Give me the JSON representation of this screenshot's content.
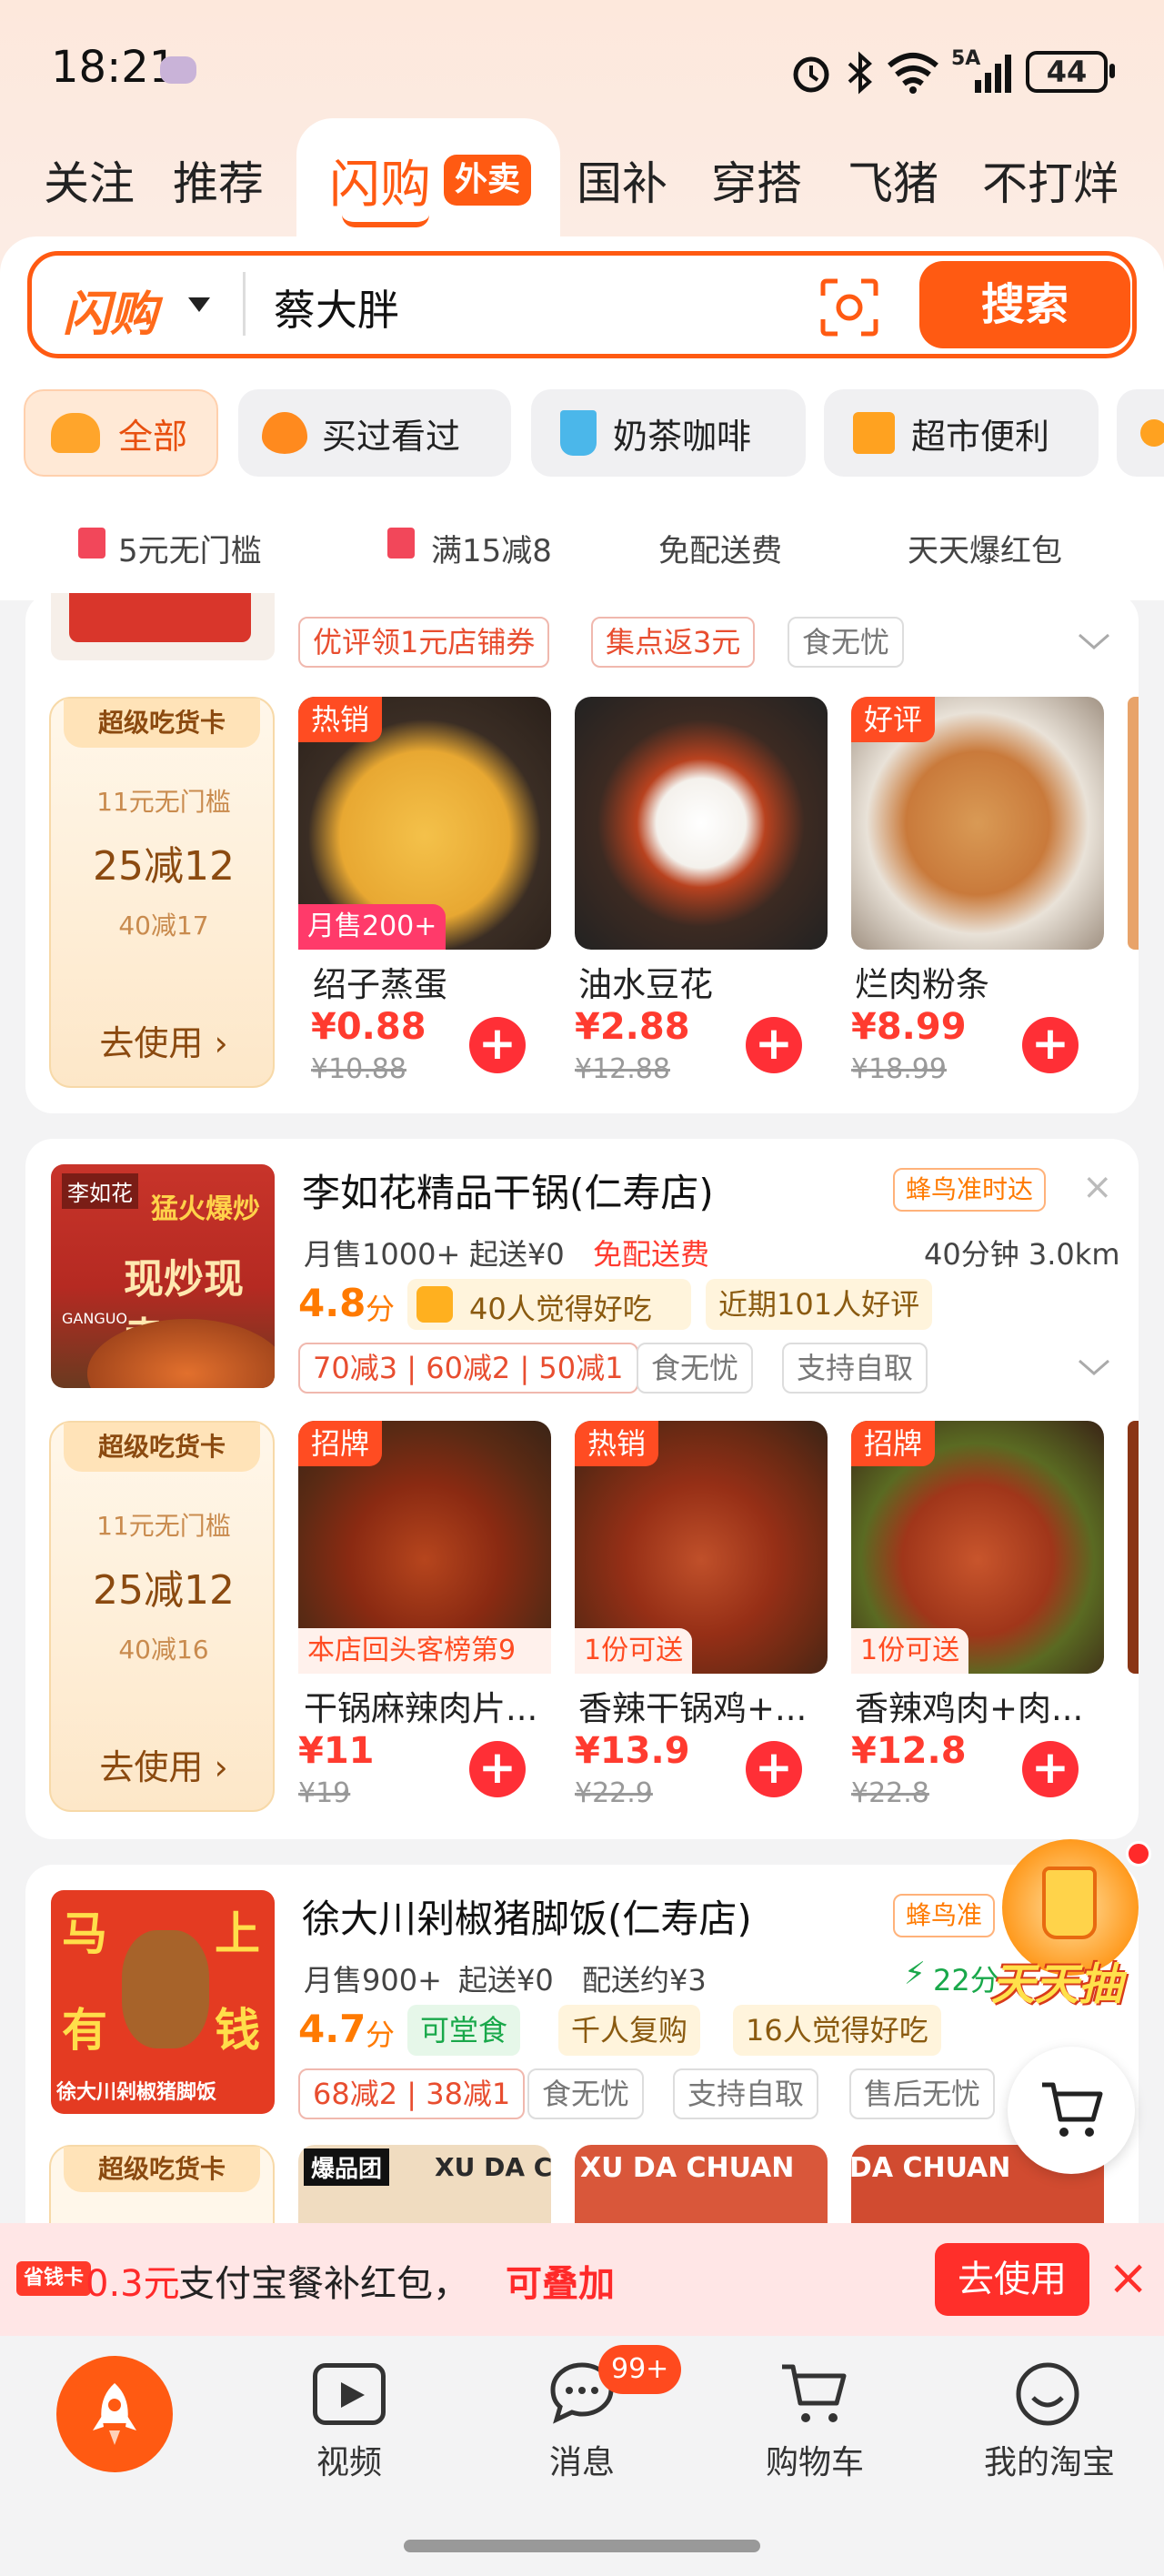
{
  "status": {
    "time": "18:21",
    "battery": "44",
    "network": "5A",
    "wifi": "6"
  },
  "tabs": [
    "关注",
    "推荐",
    "闪购",
    "外卖",
    "国补",
    "穿搭",
    "飞猪",
    "不打烊"
  ],
  "search": {
    "scope": "闪购",
    "query": "蔡大胖",
    "button": "搜索"
  },
  "chips": [
    "全部",
    "买过看过",
    "奶茶咖啡",
    "超市便利"
  ],
  "promos": [
    "5元无门槛",
    "满15减8",
    "免配送费",
    "天天爆红包"
  ],
  "shop1": {
    "tags": [
      "优评领1元店铺券",
      "集点返3元",
      "食无忧"
    ],
    "coupon": {
      "title": "超级吃货卡",
      "line1": "11元无门槛",
      "main": "25减12",
      "line3": "40减17",
      "use": "去使用"
    },
    "products": [
      {
        "badge": "热销",
        "sub": "月售200+",
        "name": "绍子蒸蛋",
        "price": "¥0.88",
        "old": "¥10.88"
      },
      {
        "badge": "",
        "sub": "",
        "name": "油水豆花",
        "price": "¥2.88",
        "old": "¥12.88"
      },
      {
        "badge": "好评",
        "sub": "",
        "name": "烂肉粉条",
        "price": "¥8.99",
        "old": "¥18.99"
      }
    ]
  },
  "shop2": {
    "name": "李如花精品干锅(仁寿店)",
    "delivery_tag": "蜂鸟准时达",
    "sales": "月售1000+",
    "min": "起送¥0",
    "free": "免配送费",
    "time_dist": "40分钟 3.0km",
    "rating": "4.8",
    "rating_unit": "分",
    "likes": "40人觉得好吃",
    "recent": "近期101人好评",
    "discounts": "70减3 | 60减2 | 50减1",
    "tags": [
      "食无忧",
      "支持自取"
    ],
    "logo_text": [
      "李如花",
      "猛火爆炒",
      "现炒现卖",
      "GANGUO"
    ],
    "coupon": {
      "title": "超级吃货卡",
      "line1": "11元无门槛",
      "main": "25减12",
      "line3": "40减16",
      "use": "去使用"
    },
    "products": [
      {
        "badge": "招牌",
        "sub": "本店回头客榜第9",
        "name": "干锅麻辣肉片...",
        "price": "¥11",
        "old": "¥19"
      },
      {
        "badge": "热销",
        "sub": "1份可送",
        "name": "香辣干锅鸡+...",
        "price": "¥13.9",
        "old": "¥22.9"
      },
      {
        "badge": "招牌",
        "sub": "1份可送",
        "name": "香辣鸡肉+肉...",
        "price": "¥12.8",
        "old": "¥22.8"
      }
    ]
  },
  "shop3": {
    "name": "徐大川剁椒猪脚饭(仁寿店)",
    "delivery_tag": "蜂鸟准",
    "sales": "月售900+",
    "min": "起送¥0",
    "fee": "配送约¥3",
    "time": "22分",
    "rating": "4.7",
    "rating_unit": "分",
    "dine": "可堂食",
    "repeat": "千人复购",
    "likes": "16人觉得好吃",
    "discounts": "68减2 | 38减1",
    "tags": [
      "食无忧",
      "支持自取",
      "售后无忧"
    ],
    "logo_text": [
      "马",
      "上",
      "有",
      "钱",
      "徐大川剁椒猪脚饭"
    ],
    "coupon_title": "超级吃货卡",
    "img_text": [
      "爆品团",
      "XU DA CHUAN",
      "XU DA CHUAN",
      "XU DA CHUAN"
    ]
  },
  "float": {
    "lottery": "天天抽"
  },
  "banner": {
    "logo": "省钱卡",
    "amount": "0.3元",
    "text": "支付宝餐补红包，",
    "stack": "可叠加",
    "button": "去使用"
  },
  "nav": {
    "video": "视频",
    "messages": "消息",
    "badge": "99+",
    "cart": "购物车",
    "mine": "我的淘宝"
  },
  "colors": {
    "accent": "#ff5a12",
    "price": "#ff3b2f",
    "rating": "#ff7a00",
    "green": "#19a84a"
  }
}
